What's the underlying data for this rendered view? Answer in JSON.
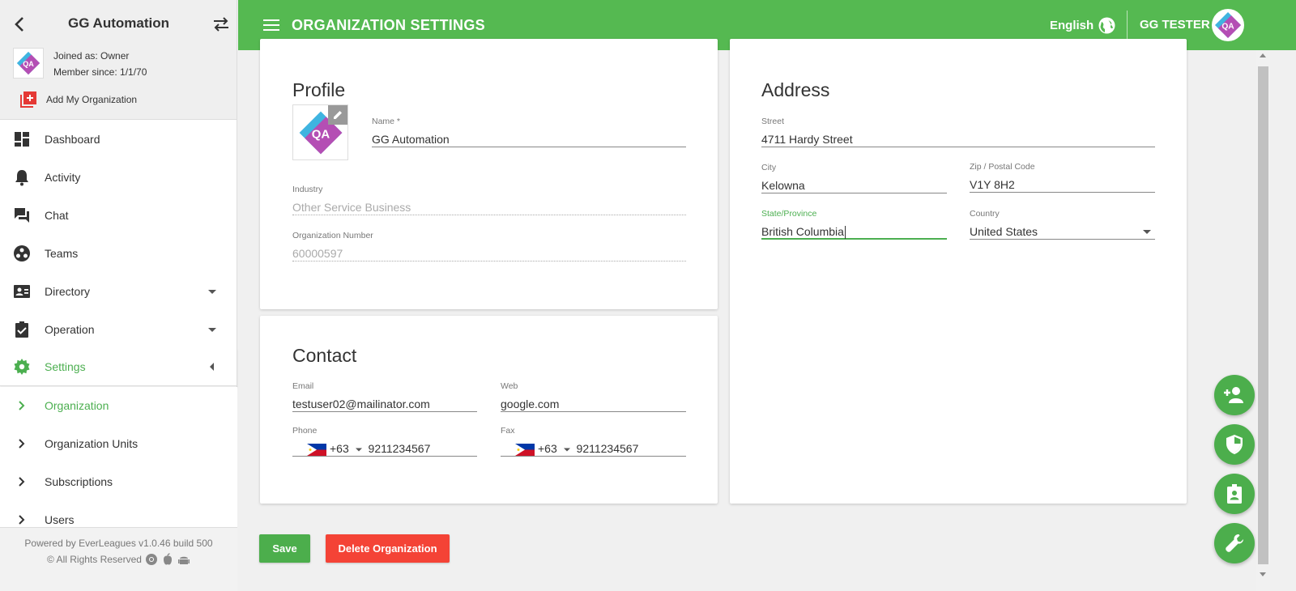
{
  "sidebar": {
    "org_name": "GG Automation",
    "joined_as": "Joined as: Owner",
    "member_since": "Member since: 1/1/70",
    "add_org_label": "Add My Organization",
    "items": [
      {
        "label": "Dashboard",
        "icon": "dashboard-icon"
      },
      {
        "label": "Activity",
        "icon": "bell-icon"
      },
      {
        "label": "Chat",
        "icon": "chat-icon"
      },
      {
        "label": "Teams",
        "icon": "teams-icon"
      },
      {
        "label": "Directory",
        "icon": "contact-card-icon"
      },
      {
        "label": "Operation",
        "icon": "clipboard-check-icon"
      },
      {
        "label": "Settings",
        "icon": "gear-icon"
      }
    ],
    "sub_items": [
      {
        "label": "Organization"
      },
      {
        "label": "Organization Units"
      },
      {
        "label": "Subscriptions"
      },
      {
        "label": "Users"
      }
    ],
    "footer_powered": "Powered by EverLeagues v1.0.46 build 500",
    "footer_rights": "© All Rights Reserved"
  },
  "topbar": {
    "title": "ORGANIZATION SETTINGS",
    "language": "English",
    "user_name": "GG TESTER"
  },
  "profile": {
    "title": "Profile",
    "name_label": "Name *",
    "name_value": "GG Automation",
    "industry_label": "Industry",
    "industry_value": "Other Service Business",
    "org_number_label": "Organization Number",
    "org_number_value": "60000597"
  },
  "contact": {
    "title": "Contact",
    "email_label": "Email",
    "email_value": "testuser02@mailinator.com",
    "web_label": "Web",
    "web_value": "google.com",
    "phone_label": "Phone",
    "phone_code": "+63",
    "phone_value": "9211234567",
    "fax_label": "Fax",
    "fax_code": "+63",
    "fax_value": "9211234567"
  },
  "address": {
    "title": "Address",
    "street_label": "Street",
    "street_value": "4711 Hardy Street",
    "city_label": "City",
    "city_value": "Kelowna",
    "zip_label": "Zip / Postal Code",
    "zip_value": "V1Y 8H2",
    "state_label": "State/Province",
    "state_value": "British Columbia",
    "country_label": "Country",
    "country_value": "United States"
  },
  "buttons": {
    "save": "Save",
    "delete": "Delete Organization"
  },
  "colors": {
    "primary": "#55b951",
    "danger": "#f44336",
    "active_text": "#4caf50"
  }
}
